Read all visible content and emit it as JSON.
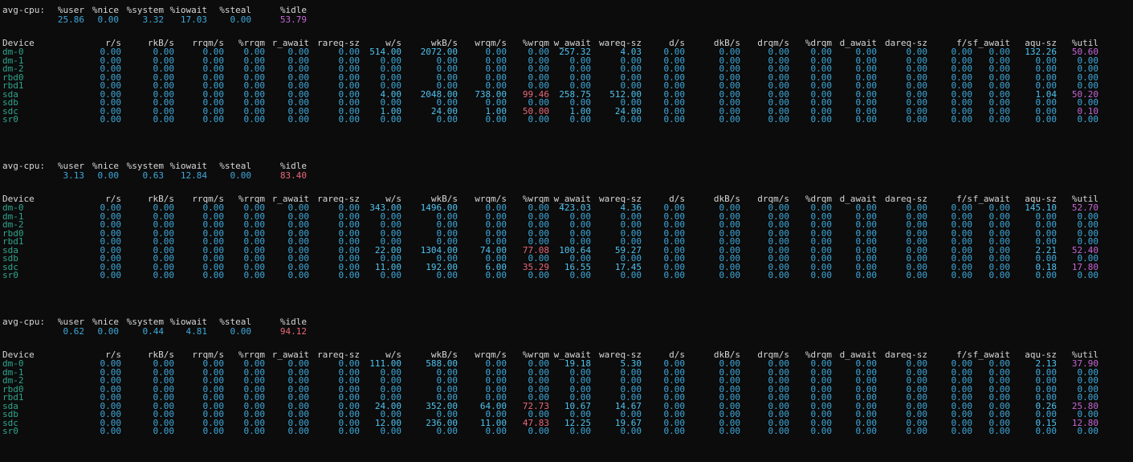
{
  "cpu_headers": [
    "avg-cpu:",
    "%user",
    "%nice",
    "%system",
    "%iowait",
    "%steal",
    "%idle"
  ],
  "device_headers": [
    "Device",
    "r/s",
    "rkB/s",
    "rrqm/s",
    "%rrqm",
    "r_await",
    "rareq-sz",
    "w/s",
    "wkB/s",
    "wrqm/s",
    "%wrqm",
    "w_await",
    "wareq-sz",
    "d/s",
    "dkB/s",
    "drqm/s",
    "%drqm",
    "d_await",
    "dareq-sz",
    "f/s",
    "f_await",
    "aqu-sz",
    "%util"
  ],
  "blocks": [
    {
      "cpu": [
        "25.86",
        "0.00",
        "3.32",
        "17.03",
        "0.00",
        "53.79"
      ],
      "devices": [
        [
          "dm-0",
          "0.00",
          "0.00",
          "0.00",
          "0.00",
          "0.00",
          "0.00",
          "514.00",
          "2072.00",
          "0.00",
          "0.00",
          "257.32",
          "4.03",
          "0.00",
          "0.00",
          "0.00",
          "0.00",
          "0.00",
          "0.00",
          "0.00",
          "0.00",
          "132.26",
          "50.60"
        ],
        [
          "dm-1",
          "0.00",
          "0.00",
          "0.00",
          "0.00",
          "0.00",
          "0.00",
          "0.00",
          "0.00",
          "0.00",
          "0.00",
          "0.00",
          "0.00",
          "0.00",
          "0.00",
          "0.00",
          "0.00",
          "0.00",
          "0.00",
          "0.00",
          "0.00",
          "0.00",
          "0.00"
        ],
        [
          "dm-2",
          "0.00",
          "0.00",
          "0.00",
          "0.00",
          "0.00",
          "0.00",
          "0.00",
          "0.00",
          "0.00",
          "0.00",
          "0.00",
          "0.00",
          "0.00",
          "0.00",
          "0.00",
          "0.00",
          "0.00",
          "0.00",
          "0.00",
          "0.00",
          "0.00",
          "0.00"
        ],
        [
          "rbd0",
          "0.00",
          "0.00",
          "0.00",
          "0.00",
          "0.00",
          "0.00",
          "0.00",
          "0.00",
          "0.00",
          "0.00",
          "0.00",
          "0.00",
          "0.00",
          "0.00",
          "0.00",
          "0.00",
          "0.00",
          "0.00",
          "0.00",
          "0.00",
          "0.00",
          "0.00"
        ],
        [
          "rbd1",
          "0.00",
          "0.00",
          "0.00",
          "0.00",
          "0.00",
          "0.00",
          "0.00",
          "0.00",
          "0.00",
          "0.00",
          "0.00",
          "0.00",
          "0.00",
          "0.00",
          "0.00",
          "0.00",
          "0.00",
          "0.00",
          "0.00",
          "0.00",
          "0.00",
          "0.00"
        ],
        [
          "sda",
          "0.00",
          "0.00",
          "0.00",
          "0.00",
          "0.00",
          "0.00",
          "4.00",
          "2048.00",
          "738.00",
          "99.46",
          "258.75",
          "512.00",
          "0.00",
          "0.00",
          "0.00",
          "0.00",
          "0.00",
          "0.00",
          "0.00",
          "0.00",
          "1.04",
          "50.20"
        ],
        [
          "sdb",
          "0.00",
          "0.00",
          "0.00",
          "0.00",
          "0.00",
          "0.00",
          "0.00",
          "0.00",
          "0.00",
          "0.00",
          "0.00",
          "0.00",
          "0.00",
          "0.00",
          "0.00",
          "0.00",
          "0.00",
          "0.00",
          "0.00",
          "0.00",
          "0.00",
          "0.00"
        ],
        [
          "sdc",
          "0.00",
          "0.00",
          "0.00",
          "0.00",
          "0.00",
          "0.00",
          "1.00",
          "24.00",
          "1.00",
          "50.00",
          "1.00",
          "24.00",
          "0.00",
          "0.00",
          "0.00",
          "0.00",
          "0.00",
          "0.00",
          "0.00",
          "0.00",
          "0.00",
          "0.10"
        ],
        [
          "sr0",
          "0.00",
          "0.00",
          "0.00",
          "0.00",
          "0.00",
          "0.00",
          "0.00",
          "0.00",
          "0.00",
          "0.00",
          "0.00",
          "0.00",
          "0.00",
          "0.00",
          "0.00",
          "0.00",
          "0.00",
          "0.00",
          "0.00",
          "0.00",
          "0.00",
          "0.00"
        ]
      ]
    },
    {
      "cpu": [
        "3.13",
        "0.00",
        "0.63",
        "12.84",
        "0.00",
        "83.40"
      ],
      "devices": [
        [
          "dm-0",
          "0.00",
          "0.00",
          "0.00",
          "0.00",
          "0.00",
          "0.00",
          "343.00",
          "1496.00",
          "0.00",
          "0.00",
          "423.03",
          "4.36",
          "0.00",
          "0.00",
          "0.00",
          "0.00",
          "0.00",
          "0.00",
          "0.00",
          "0.00",
          "145.10",
          "52.70"
        ],
        [
          "dm-1",
          "0.00",
          "0.00",
          "0.00",
          "0.00",
          "0.00",
          "0.00",
          "0.00",
          "0.00",
          "0.00",
          "0.00",
          "0.00",
          "0.00",
          "0.00",
          "0.00",
          "0.00",
          "0.00",
          "0.00",
          "0.00",
          "0.00",
          "0.00",
          "0.00",
          "0.00"
        ],
        [
          "dm-2",
          "0.00",
          "0.00",
          "0.00",
          "0.00",
          "0.00",
          "0.00",
          "0.00",
          "0.00",
          "0.00",
          "0.00",
          "0.00",
          "0.00",
          "0.00",
          "0.00",
          "0.00",
          "0.00",
          "0.00",
          "0.00",
          "0.00",
          "0.00",
          "0.00",
          "0.00"
        ],
        [
          "rbd0",
          "0.00",
          "0.00",
          "0.00",
          "0.00",
          "0.00",
          "0.00",
          "0.00",
          "0.00",
          "0.00",
          "0.00",
          "0.00",
          "0.00",
          "0.00",
          "0.00",
          "0.00",
          "0.00",
          "0.00",
          "0.00",
          "0.00",
          "0.00",
          "0.00",
          "0.00"
        ],
        [
          "rbd1",
          "0.00",
          "0.00",
          "0.00",
          "0.00",
          "0.00",
          "0.00",
          "0.00",
          "0.00",
          "0.00",
          "0.00",
          "0.00",
          "0.00",
          "0.00",
          "0.00",
          "0.00",
          "0.00",
          "0.00",
          "0.00",
          "0.00",
          "0.00",
          "0.00",
          "0.00"
        ],
        [
          "sda",
          "0.00",
          "0.00",
          "0.00",
          "0.00",
          "0.00",
          "0.00",
          "22.00",
          "1304.00",
          "74.00",
          "77.08",
          "100.64",
          "59.27",
          "0.00",
          "0.00",
          "0.00",
          "0.00",
          "0.00",
          "0.00",
          "0.00",
          "0.00",
          "2.21",
          "52.40"
        ],
        [
          "sdb",
          "0.00",
          "0.00",
          "0.00",
          "0.00",
          "0.00",
          "0.00",
          "0.00",
          "0.00",
          "0.00",
          "0.00",
          "0.00",
          "0.00",
          "0.00",
          "0.00",
          "0.00",
          "0.00",
          "0.00",
          "0.00",
          "0.00",
          "0.00",
          "0.00",
          "0.00"
        ],
        [
          "sdc",
          "0.00",
          "0.00",
          "0.00",
          "0.00",
          "0.00",
          "0.00",
          "11.00",
          "192.00",
          "6.00",
          "35.29",
          "16.55",
          "17.45",
          "0.00",
          "0.00",
          "0.00",
          "0.00",
          "0.00",
          "0.00",
          "0.00",
          "0.00",
          "0.18",
          "17.80"
        ],
        [
          "sr0",
          "0.00",
          "0.00",
          "0.00",
          "0.00",
          "0.00",
          "0.00",
          "0.00",
          "0.00",
          "0.00",
          "0.00",
          "0.00",
          "0.00",
          "0.00",
          "0.00",
          "0.00",
          "0.00",
          "0.00",
          "0.00",
          "0.00",
          "0.00",
          "0.00",
          "0.00"
        ]
      ]
    },
    {
      "cpu": [
        "0.62",
        "0.00",
        "0.44",
        "4.81",
        "0.00",
        "94.12"
      ],
      "devices": [
        [
          "dm-0",
          "0.00",
          "0.00",
          "0.00",
          "0.00",
          "0.00",
          "0.00",
          "111.00",
          "588.00",
          "0.00",
          "0.00",
          "19.18",
          "5.30",
          "0.00",
          "0.00",
          "0.00",
          "0.00",
          "0.00",
          "0.00",
          "0.00",
          "0.00",
          "2.13",
          "37.90"
        ],
        [
          "dm-1",
          "0.00",
          "0.00",
          "0.00",
          "0.00",
          "0.00",
          "0.00",
          "0.00",
          "0.00",
          "0.00",
          "0.00",
          "0.00",
          "0.00",
          "0.00",
          "0.00",
          "0.00",
          "0.00",
          "0.00",
          "0.00",
          "0.00",
          "0.00",
          "0.00",
          "0.00"
        ],
        [
          "dm-2",
          "0.00",
          "0.00",
          "0.00",
          "0.00",
          "0.00",
          "0.00",
          "0.00",
          "0.00",
          "0.00",
          "0.00",
          "0.00",
          "0.00",
          "0.00",
          "0.00",
          "0.00",
          "0.00",
          "0.00",
          "0.00",
          "0.00",
          "0.00",
          "0.00",
          "0.00"
        ],
        [
          "rbd0",
          "0.00",
          "0.00",
          "0.00",
          "0.00",
          "0.00",
          "0.00",
          "0.00",
          "0.00",
          "0.00",
          "0.00",
          "0.00",
          "0.00",
          "0.00",
          "0.00",
          "0.00",
          "0.00",
          "0.00",
          "0.00",
          "0.00",
          "0.00",
          "0.00",
          "0.00"
        ],
        [
          "rbd1",
          "0.00",
          "0.00",
          "0.00",
          "0.00",
          "0.00",
          "0.00",
          "0.00",
          "0.00",
          "0.00",
          "0.00",
          "0.00",
          "0.00",
          "0.00",
          "0.00",
          "0.00",
          "0.00",
          "0.00",
          "0.00",
          "0.00",
          "0.00",
          "0.00",
          "0.00"
        ],
        [
          "sda",
          "0.00",
          "0.00",
          "0.00",
          "0.00",
          "0.00",
          "0.00",
          "24.00",
          "352.00",
          "64.00",
          "72.73",
          "10.67",
          "14.67",
          "0.00",
          "0.00",
          "0.00",
          "0.00",
          "0.00",
          "0.00",
          "0.00",
          "0.00",
          "0.26",
          "25.80"
        ],
        [
          "sdb",
          "0.00",
          "0.00",
          "0.00",
          "0.00",
          "0.00",
          "0.00",
          "0.00",
          "0.00",
          "0.00",
          "0.00",
          "0.00",
          "0.00",
          "0.00",
          "0.00",
          "0.00",
          "0.00",
          "0.00",
          "0.00",
          "0.00",
          "0.00",
          "0.00",
          "0.00"
        ],
        [
          "sdc",
          "0.00",
          "0.00",
          "0.00",
          "0.00",
          "0.00",
          "0.00",
          "12.00",
          "236.00",
          "11.00",
          "47.83",
          "12.25",
          "19.67",
          "0.00",
          "0.00",
          "0.00",
          "0.00",
          "0.00",
          "0.00",
          "0.00",
          "0.00",
          "0.15",
          "12.80"
        ],
        [
          "sr0",
          "0.00",
          "0.00",
          "0.00",
          "0.00",
          "0.00",
          "0.00",
          "0.00",
          "0.00",
          "0.00",
          "0.00",
          "0.00",
          "0.00",
          "0.00",
          "0.00",
          "0.00",
          "0.00",
          "0.00",
          "0.00",
          "0.00",
          "0.00",
          "0.00",
          "0.00"
        ]
      ]
    }
  ]
}
